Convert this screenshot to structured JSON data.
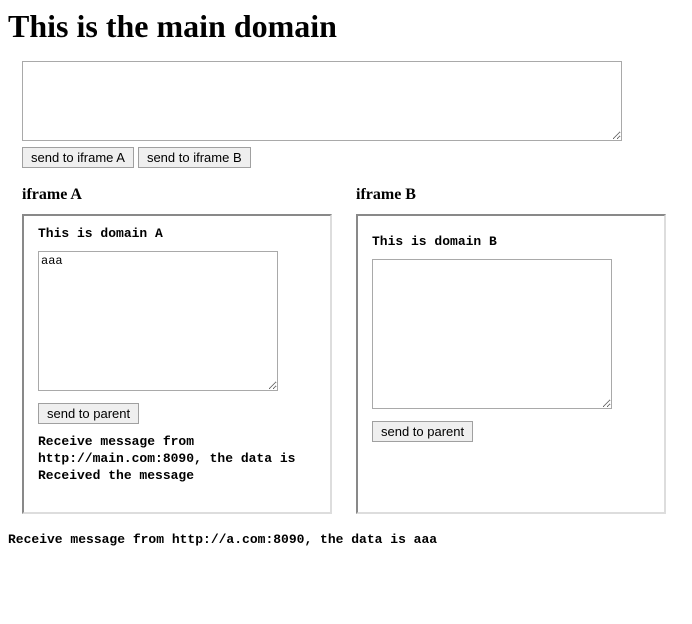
{
  "header": {
    "title": "This is the main domain"
  },
  "main": {
    "textarea_value": "",
    "send_a_label": "send to iframe A",
    "send_b_label": "send to iframe B"
  },
  "iframes": {
    "a": {
      "title": "iframe A",
      "domain_header": "This is domain A",
      "textarea_value": "aaa",
      "send_parent_label": "send to parent",
      "receive_text": "Receive message from http://main.com:8090, the data is Received the message"
    },
    "b": {
      "title": "iframe B",
      "domain_header": "This is domain B",
      "textarea_value": "",
      "send_parent_label": "send to parent",
      "receive_text": ""
    }
  },
  "footer": {
    "receive_text": "Receive message from http://a.com:8090, the data is aaa"
  }
}
